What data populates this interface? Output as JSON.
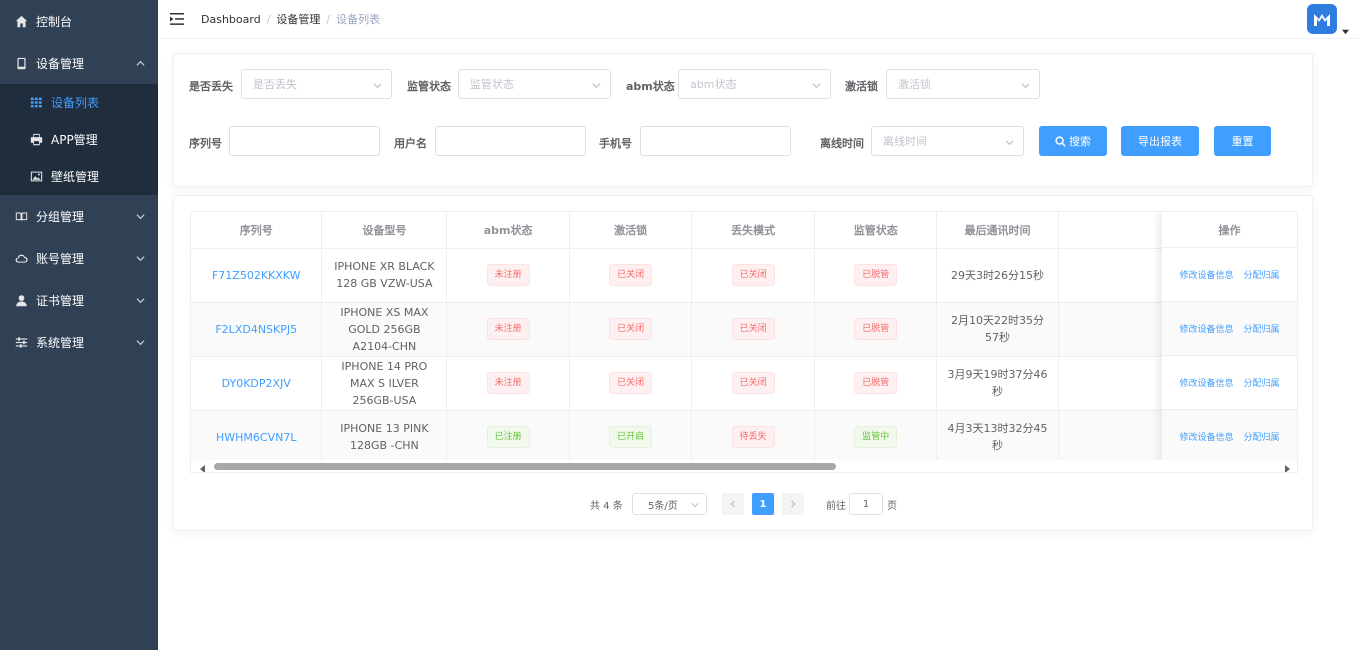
{
  "sidebar": {
    "items": [
      {
        "label": "控制台"
      },
      {
        "label": "设备管理"
      },
      {
        "label": "分组管理"
      },
      {
        "label": "账号管理"
      },
      {
        "label": "证书管理"
      },
      {
        "label": "系统管理"
      }
    ],
    "sub_items": [
      {
        "label": "设备列表"
      },
      {
        "label": "APP管理"
      },
      {
        "label": "壁纸管理"
      }
    ]
  },
  "breadcrumb": [
    "Dashboard",
    "设备管理",
    "设备列表"
  ],
  "filters": {
    "lost": {
      "label": "是否丢失",
      "placeholder": "是否丢失"
    },
    "supervise": {
      "label": "监管状态",
      "placeholder": "监管状态"
    },
    "abm": {
      "label": "abm状态",
      "placeholder": "abm状态"
    },
    "activation": {
      "label": "激活锁",
      "placeholder": "激活锁"
    },
    "serial": {
      "label": "序列号",
      "value": ""
    },
    "username": {
      "label": "用户名",
      "value": ""
    },
    "phone": {
      "label": "手机号",
      "value": ""
    },
    "offline": {
      "label": "离线时间",
      "placeholder": "离线时间"
    },
    "search_btn": "搜索",
    "export_btn": "导出报表",
    "reset_btn": "重置"
  },
  "table": {
    "headers": [
      "序列号",
      "设备型号",
      "abm状态",
      "激活锁",
      "丢失模式",
      "监管状态",
      "最后通讯时间",
      "",
      "操作"
    ],
    "rows": [
      {
        "serial": "F71Z502KKXKW",
        "model": "IPHONE XR BLACK 128 GB VZW-USA",
        "abm": "未注册",
        "lock": "已关闭",
        "lost": "已关闭",
        "supervise": "已脱管",
        "last": "29天3时26分15秒"
      },
      {
        "serial": "F2LXD4NSKPJ5",
        "model": "IPHONE XS MAX GOLD 256GB A2104-CHN",
        "abm": "未注册",
        "lock": "已关闭",
        "lost": "已关闭",
        "supervise": "已脱管",
        "last": "2月10天22时35分57秒"
      },
      {
        "serial": "DY0KDP2XJV",
        "model": "IPHONE 14 PRO MAX S ILVER 256GB-USA",
        "abm": "未注册",
        "lock": "已关闭",
        "lost": "已关闭",
        "supervise": "已脱管",
        "last": "3月9天19时37分46秒"
      },
      {
        "serial": "HWHM6CVN7L",
        "model": "IPHONE 13 PINK 128GB -CHN",
        "abm": "已注册",
        "lock": "已开启",
        "lost": "待丢失",
        "supervise": "监管中",
        "last": "4月3天13时32分45秒"
      }
    ],
    "actions": {
      "edit": "修改设备信息",
      "assign": "分配归属"
    }
  },
  "pagination": {
    "total": "共 4 条",
    "page_size": "5条/页",
    "current": "1",
    "goto_label": "前往",
    "goto_value": "1",
    "page_suffix": "页"
  },
  "colors": {
    "primary": "#409eff",
    "sidebar": "#304156",
    "danger": "#f56c6c",
    "success": "#67c23a"
  }
}
